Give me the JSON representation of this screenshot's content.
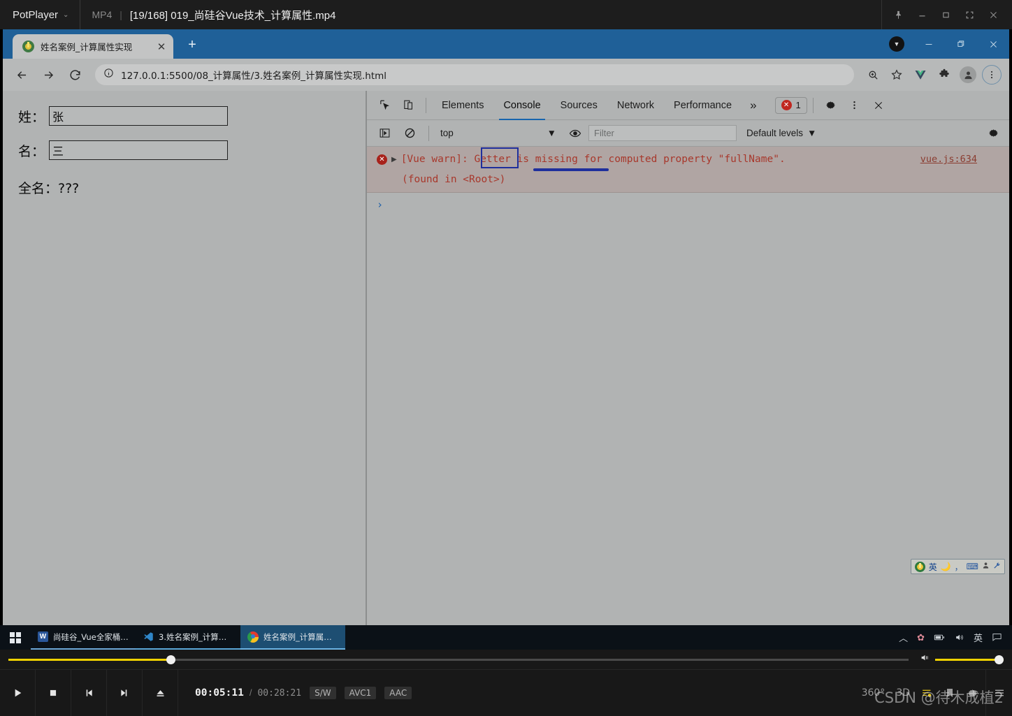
{
  "potplayer": {
    "app_name": "PotPlayer",
    "format": "MP4",
    "file_title": "[19/168] 019_尚硅谷Vue技术_计算属性.mp4",
    "window_buttons": [
      "pin-icon",
      "minimize-icon",
      "maximize-icon",
      "fullscreen-icon",
      "close-icon"
    ],
    "transport": {
      "play_label": "play-icon",
      "stop_label": "stop-icon",
      "prev_label": "previous-icon",
      "next_label": "next-icon",
      "eject_label": "eject-icon"
    },
    "time_current": "00:05:11",
    "time_separator": "/",
    "time_total": "00:28:21",
    "chips": [
      "S/W",
      "AVC1",
      "AAC"
    ],
    "right_buttons": [
      "360°",
      "3D"
    ],
    "progress_percent": 18,
    "volume_percent": 100,
    "watermark": "CSDN @待木成植2"
  },
  "browser": {
    "tab": {
      "title": "姓名案例_计算属性实现",
      "close_label": "✕",
      "favicon": "live-server-icon"
    },
    "new_tab_label": "+",
    "window_buttons": [
      "download-icon",
      "minimize-icon",
      "restore-icon",
      "close-icon"
    ],
    "nav": {
      "back_label": "back-arrow-icon",
      "forward_label": "forward-arrow-icon",
      "reload_label": "reload-icon"
    },
    "omnibox": {
      "site_info": "info-circle-icon",
      "url": "127.0.0.1:5500/08_计算属性/3.姓名案例_计算属性实现.html"
    },
    "toolbar_icons": [
      "zoom-icon",
      "bookmark-star-icon",
      "vue-devtools-icon",
      "extensions-puzzle-icon",
      "profile-avatar-icon",
      "chrome-menu-icon"
    ]
  },
  "page": {
    "fields": [
      {
        "label": "姓：",
        "value": "张"
      },
      {
        "label": "名：",
        "value": "三"
      }
    ],
    "fullname_line": "全名：???"
  },
  "devtools": {
    "left_icons": [
      "inspect-element-icon",
      "device-toolbar-icon"
    ],
    "tabs": [
      {
        "label": "Elements",
        "active": false
      },
      {
        "label": "Console",
        "active": true
      },
      {
        "label": "Sources",
        "active": false
      },
      {
        "label": "Network",
        "active": false
      },
      {
        "label": "Performance",
        "active": false
      }
    ],
    "more_tabs_label": "»",
    "error_badge_count": "1",
    "settings_label": "settings-gear-icon",
    "kebab_label": "more-options-icon",
    "close_label": "close-devtools-icon",
    "filterbar": {
      "sidebar_toggle": "console-sidebar-icon",
      "clear_console": "clear-console-icon",
      "context": "top",
      "context_caret": "▼",
      "eye_label": "live-expression-icon",
      "filter_placeholder": "Filter",
      "levels_label": "Default levels",
      "levels_caret": "▼",
      "settings_label": "console-settings-icon"
    },
    "console": {
      "message_prefix": "[Vue warn]: ",
      "message_highlight": "Getter",
      "message_rest": " is missing for computed property \"fullName\".",
      "message_full": "[Vue warn]: Getter is missing for computed property \"fullName\".",
      "source": "vue.js:634",
      "found_in": "(found in <Root>)",
      "prompt": "›",
      "expand_triangle": "▶"
    }
  },
  "ime": {
    "items": [
      "sogou-logo-icon",
      "英",
      "moon-icon",
      "comma-icon",
      "keyboard-icon",
      "person-icon",
      "wrench-icon"
    ]
  },
  "taskbar": {
    "start_label": "windows-start-icon",
    "items": [
      {
        "label": "尚硅谷_Vue全家桶.d...",
        "icon": "word-icon",
        "active": false
      },
      {
        "label": "3.姓名案例_计算属...",
        "icon": "vscode-icon",
        "active": false
      },
      {
        "label": "姓名案例_计算属性实...",
        "icon": "chrome-icon",
        "active": true
      }
    ],
    "tray": [
      "chevron-up-icon",
      "flower-icon",
      "battery-icon",
      "volume-icon",
      "英",
      "notification-icon"
    ]
  },
  "colors": {
    "accent_blue": "#1f6098",
    "error_red": "#a8382c",
    "annotation_blue": "#1f2f9c",
    "player_yellow": "#f2d200",
    "page_gray": "#b1b3b3"
  }
}
